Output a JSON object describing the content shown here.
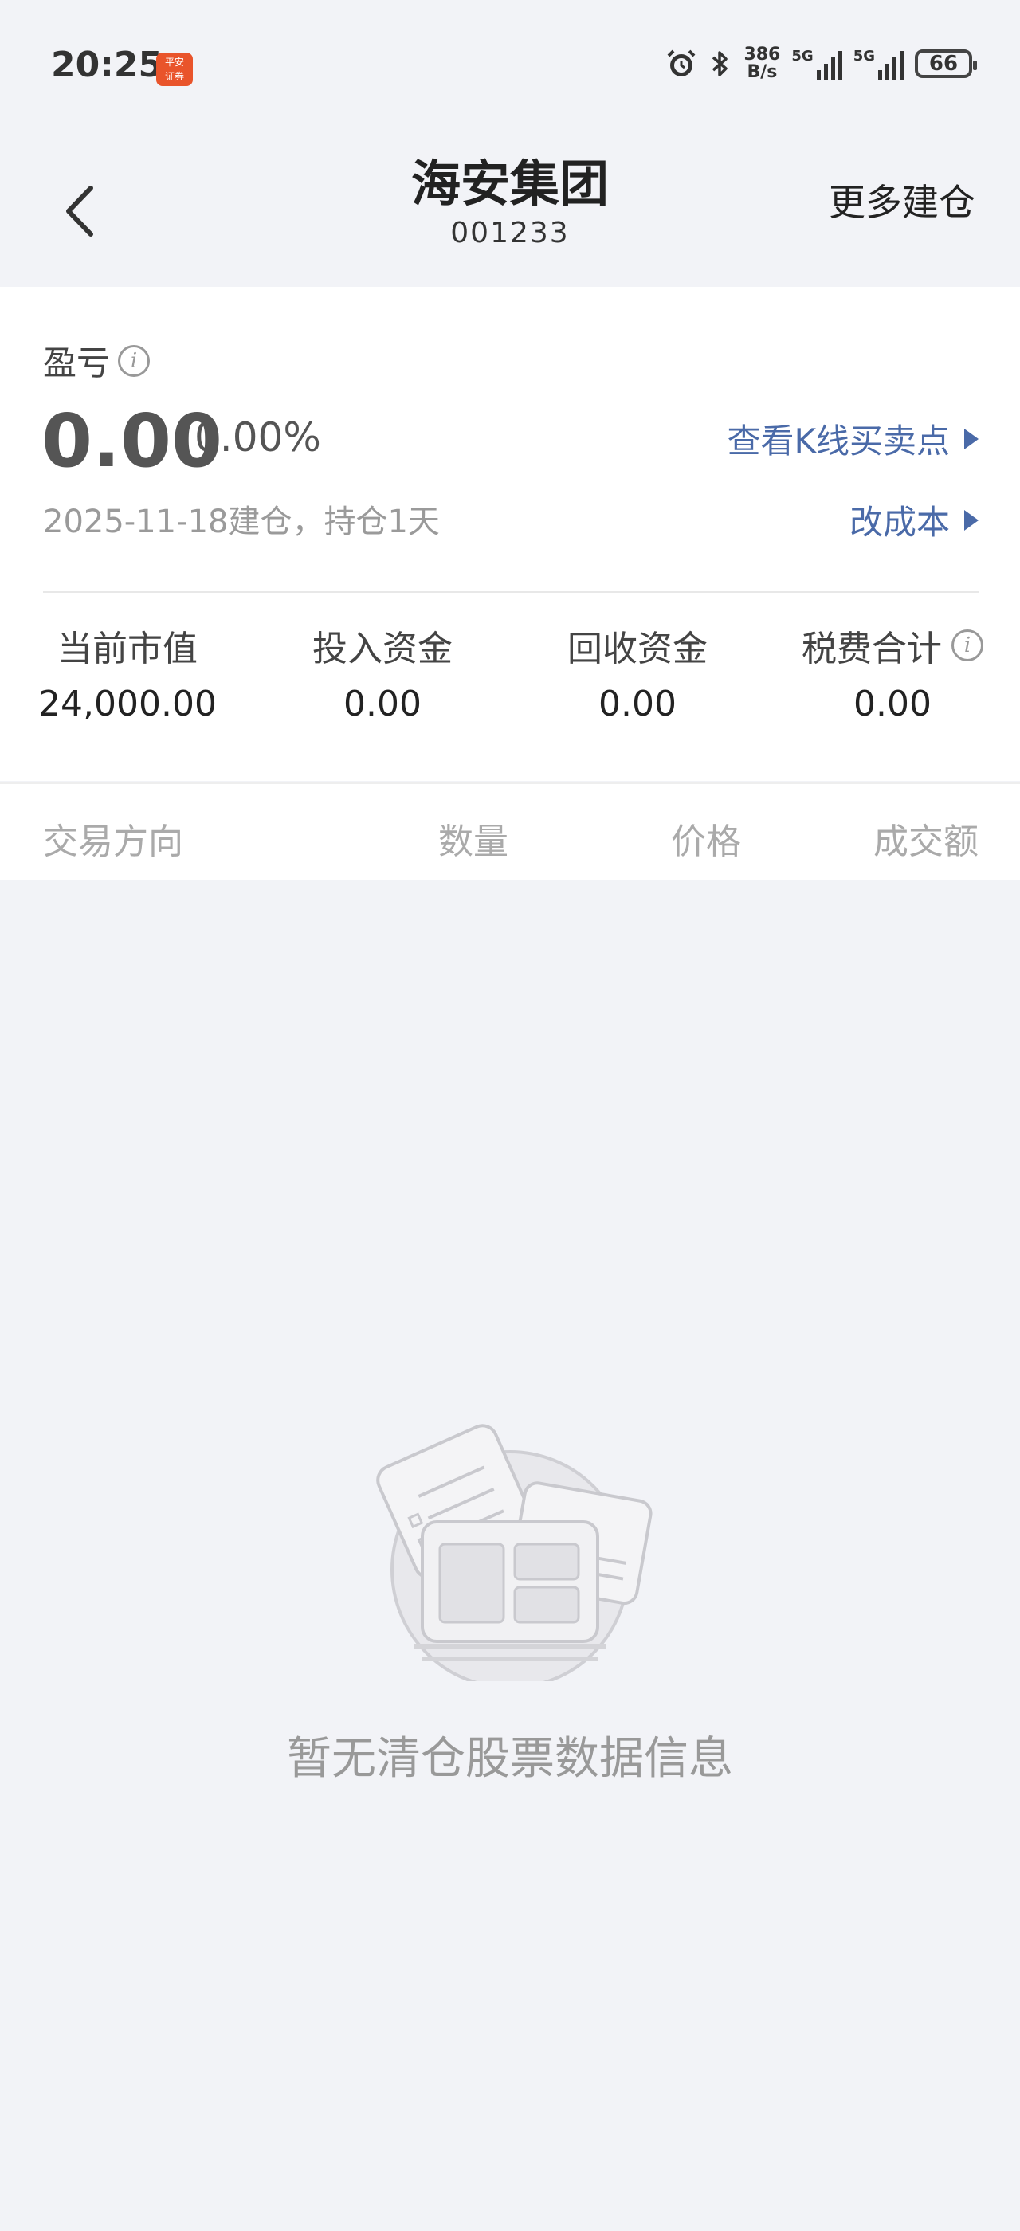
{
  "status_bar": {
    "time": "20:25",
    "app_badge_line1": "平安",
    "app_badge_line2": "证券",
    "net_speed_value": "386",
    "net_speed_unit": "B/s",
    "signal1_label": "5G",
    "signal2_label": "5G",
    "battery": "66",
    "icons": [
      "alarm-icon",
      "bluetooth-icon",
      "signal-icon",
      "battery-icon"
    ]
  },
  "header": {
    "title": "海安集团",
    "code": "001233",
    "more_label": "更多建仓"
  },
  "profit": {
    "label": "盈亏",
    "value": "0.00",
    "percent": "0.00%",
    "kline_link": "查看K线买卖点",
    "open_info": "2025-11-18建仓，持仓1天",
    "cost_link": "改成本"
  },
  "stats": [
    {
      "label": "当前市值",
      "value": "24,000.00"
    },
    {
      "label": "投入资金",
      "value": "0.00"
    },
    {
      "label": "回收资金",
      "value": "0.00"
    },
    {
      "label": "税费合计",
      "value": "0.00"
    }
  ],
  "table": {
    "headers": [
      "交易方向",
      "数量",
      "价格",
      "成交额"
    ]
  },
  "empty_state": {
    "message": "暂无清仓股票数据信息"
  },
  "colors": {
    "link": "#4a6aa8",
    "background": "#f2f3f7",
    "badge": "#e9542b"
  }
}
